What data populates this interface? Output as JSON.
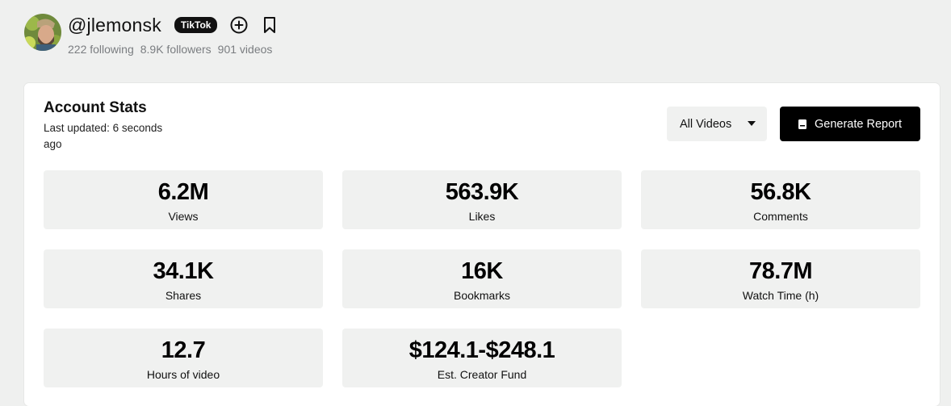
{
  "profile": {
    "handle": "@jlemonsk",
    "platform": "TikTok",
    "following": "222 following",
    "followers": "8.9K followers",
    "videos": "901 videos",
    "icons": [
      "add-circle-icon",
      "bookmark-icon"
    ]
  },
  "stats_card": {
    "title": "Account Stats",
    "last_updated": "Last updated: 6 seconds ago",
    "filter_selected": "All Videos",
    "report_button": "Generate Report",
    "stats": [
      {
        "value": "6.2M",
        "label": "Views"
      },
      {
        "value": "563.9K",
        "label": "Likes"
      },
      {
        "value": "56.8K",
        "label": "Comments"
      },
      {
        "value": "34.1K",
        "label": "Shares"
      },
      {
        "value": "16K",
        "label": "Bookmarks"
      },
      {
        "value": "78.7M",
        "label": "Watch Time (h)"
      },
      {
        "value": "12.7",
        "label": "Hours of video"
      },
      {
        "value": "$124.1-$248.1",
        "label": "Est. Creator Fund"
      }
    ]
  },
  "colors": {
    "page_bg": "#eff0ef",
    "card_bg": "#ffffff",
    "tile_bg": "#f0f1f0",
    "primary_button": "#000000",
    "muted_text": "#7a7d80"
  }
}
